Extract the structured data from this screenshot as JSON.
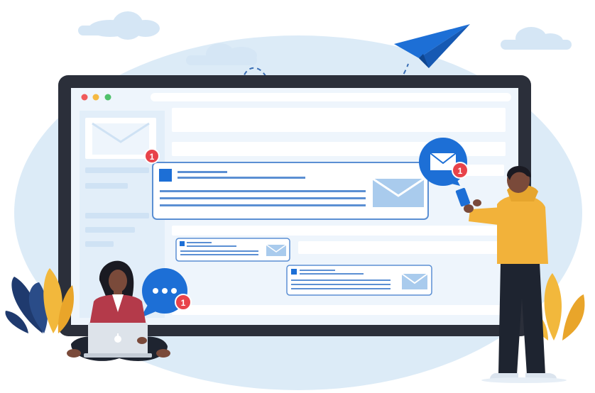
{
  "illustration": {
    "colors": {
      "background_blob": "#dcebf7",
      "cloud": "#d5e6f5",
      "monitor_frame": "#2b2f3a",
      "screen": "#eef5fc",
      "ui_block": "#cfe2f4",
      "email_card_border": "#5b8fd3",
      "accent_blue": "#1d6fd6",
      "notification_red": "#e8434a",
      "window_dot_red": "#f05a5a",
      "window_dot_yellow": "#f5b942",
      "window_dot_green": "#4fc16b",
      "person_skin": "#7a4a3a",
      "woman_sweater": "#b43a4a",
      "man_hoodie": "#f2b23a",
      "pants_dark": "#1e2430",
      "plant_yellow": "#f2b83c",
      "plant_navy": "#1f3a6e"
    },
    "badges": {
      "card_badge": "1",
      "mail_bubble_badge": "1",
      "chat_bubble_badge": "1"
    },
    "icons": [
      "paper-plane-icon",
      "envelope-icon",
      "chat-bubble-icon",
      "apple-logo-icon"
    ]
  }
}
